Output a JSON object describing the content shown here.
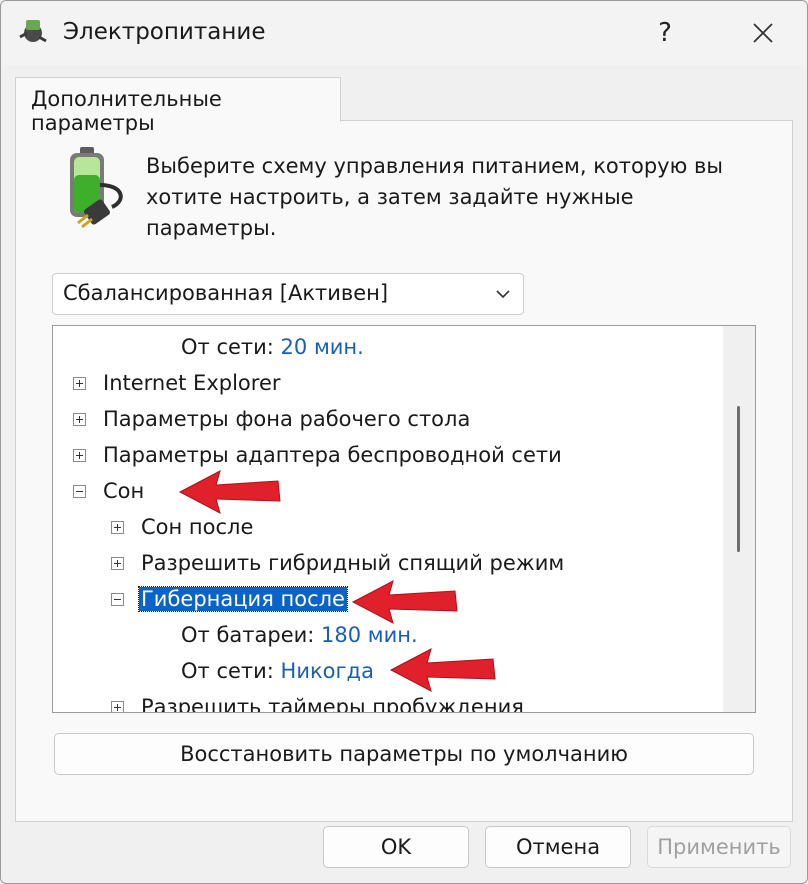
{
  "window": {
    "title": "Электропитание",
    "help_label": "?"
  },
  "tab": {
    "label": "Дополнительные параметры"
  },
  "intro": {
    "text": "Выберите схему управления питанием, которую вы хотите настроить, а затем задайте нужные параметры."
  },
  "plan_select": {
    "value": "Сбалансированная [Активен]"
  },
  "tree": {
    "row_ac_top": {
      "label": "От сети:",
      "value": "20 мин."
    },
    "internet_explorer": "Internet Explorer",
    "desktop_background": "Параметры фона рабочего стола",
    "wireless_adapter": "Параметры адаптера беспроводной сети",
    "sleep": "Сон",
    "sleep_after": "Сон после",
    "hybrid_sleep": "Разрешить гибридный спящий режим",
    "hibernate_after": "Гибернация после",
    "on_battery": {
      "label": "От батареи:",
      "value": "180 мин."
    },
    "plugged_in": {
      "label": "От сети:",
      "value": "Никогда"
    },
    "wake_timers": "Разрешить таймеры пробуждения"
  },
  "buttons": {
    "restore": "Восстановить параметры по умолчанию",
    "ok": "OK",
    "cancel": "Отмена",
    "apply": "Применить"
  },
  "colors": {
    "selection": "#0a64c8",
    "value_text": "#1a5fb4",
    "arrow": "#e0202a"
  },
  "icons": [
    "power-options-icon",
    "help-icon",
    "close-icon",
    "battery-plug-icon",
    "chevron-down-icon",
    "expand-plus-icon",
    "collapse-minus-icon",
    "red-arrow-annotation"
  ]
}
